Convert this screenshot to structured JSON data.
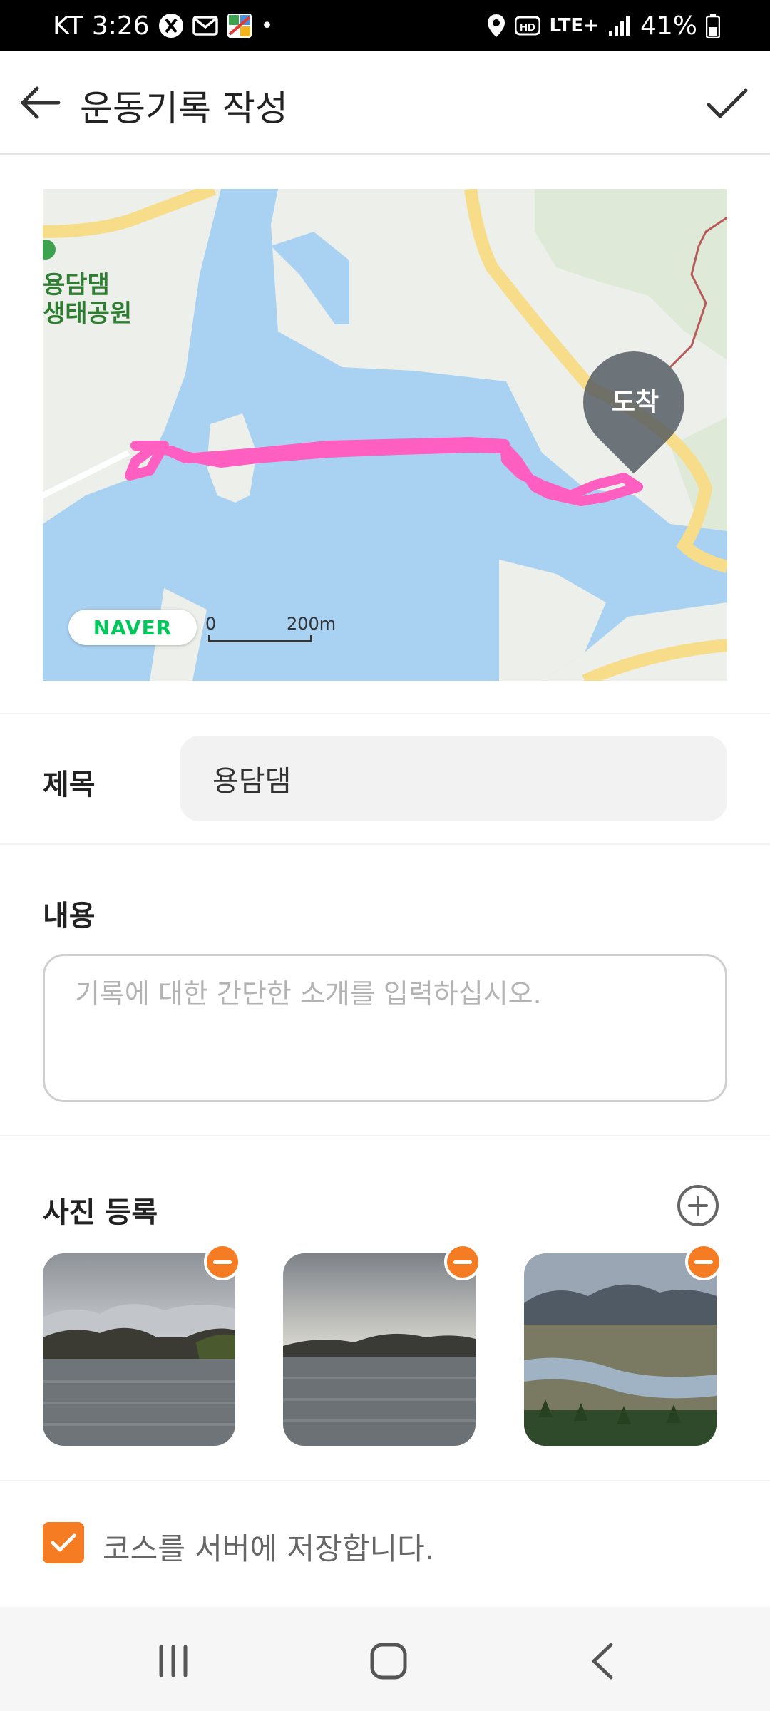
{
  "status_bar": {
    "carrier": "KT",
    "time": "3:26",
    "network": "LTE+",
    "battery": "41%"
  },
  "app_bar": {
    "title": "운동기록 작성"
  },
  "map": {
    "area_label_line1": "용담댐",
    "area_label_line2": "생태공원",
    "arrival_marker": "도착",
    "provider_badge": "NAVER",
    "scale_start": "0",
    "scale_distance": "200m",
    "route_color": "#ff5fc0",
    "water_color": "#a9d2f2",
    "road_color": "#f7dc8a"
  },
  "form": {
    "title_label": "제목",
    "title_value": "용담댐",
    "content_label": "내용",
    "content_placeholder": "기록에 대한 간단한 소개를 입력하십시오.",
    "photos_label": "사진 등록",
    "save_course_label": "코스를 서버에 저장합니다.",
    "save_course_checked": true
  },
  "photos": [
    {
      "scene": "lake with cloudy sky and mountains"
    },
    {
      "scene": "lake with cloudy sky and mountains"
    },
    {
      "scene": "river valley with town and mountains"
    }
  ],
  "accent_color": "#f57c22"
}
